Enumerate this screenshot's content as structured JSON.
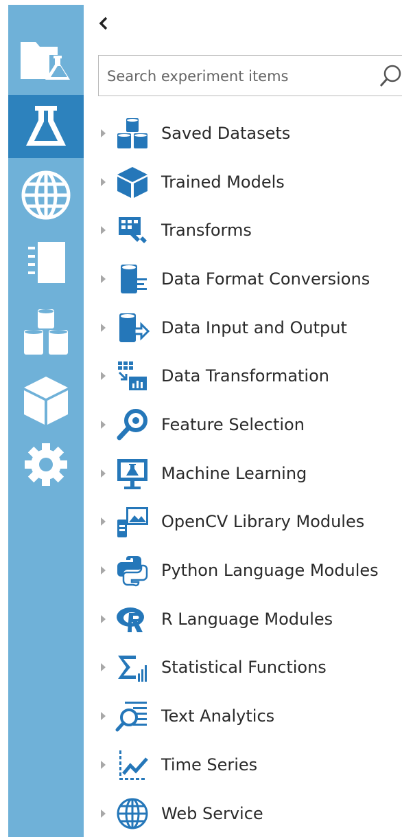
{
  "nav": {
    "items": [
      {
        "icon": "folder-flask-icon",
        "active": false
      },
      {
        "icon": "flask-icon",
        "active": true
      },
      {
        "icon": "globe-icon",
        "active": false
      },
      {
        "icon": "notebook-icon",
        "active": false
      },
      {
        "icon": "datasets-icon",
        "active": false
      },
      {
        "icon": "cube-icon",
        "active": false
      },
      {
        "icon": "gear-icon",
        "active": false
      }
    ]
  },
  "palette": {
    "collapse_glyph": "‹",
    "search": {
      "placeholder": "Search experiment items",
      "value": ""
    },
    "categories": [
      {
        "label": "Saved Datasets",
        "icon": "datasets-icon"
      },
      {
        "label": "Trained Models",
        "icon": "cube-icon"
      },
      {
        "label": "Transforms",
        "icon": "transforms-icon"
      },
      {
        "label": "Data Format Conversions",
        "icon": "data-format-icon"
      },
      {
        "label": "Data Input and Output",
        "icon": "data-input-output-icon"
      },
      {
        "label": "Data Transformation",
        "icon": "data-transformation-icon"
      },
      {
        "label": "Feature Selection",
        "icon": "magnifier-icon"
      },
      {
        "label": "Machine Learning",
        "icon": "monitor-flask-icon"
      },
      {
        "label": "OpenCV Library Modules",
        "icon": "opencv-icon"
      },
      {
        "label": "Python Language Modules",
        "icon": "python-icon"
      },
      {
        "label": "R Language Modules",
        "icon": "r-language-icon"
      },
      {
        "label": "Statistical Functions",
        "icon": "sigma-chart-icon"
      },
      {
        "label": "Text Analytics",
        "icon": "text-analytics-icon"
      },
      {
        "label": "Time Series",
        "icon": "time-series-icon"
      },
      {
        "label": "Web Service",
        "icon": "globe-icon"
      }
    ]
  },
  "colors": {
    "rail": "#6fb1d8",
    "rail_active": "#2d82bd",
    "icon_blue": "#2577b9",
    "caret": "#a8a8a8",
    "text": "#2a2a2a"
  }
}
